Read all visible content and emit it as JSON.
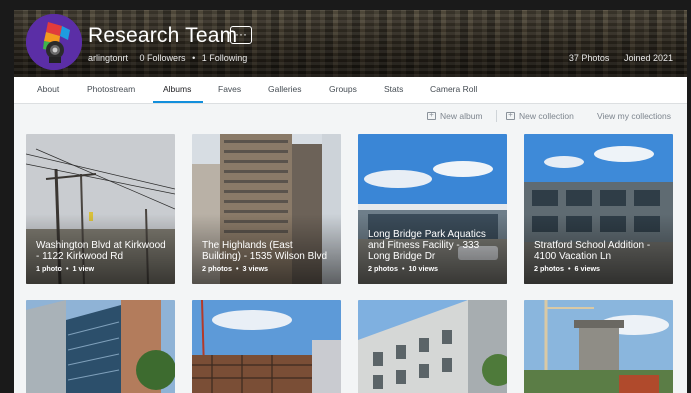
{
  "profile": {
    "name": "Research Team",
    "more_label": "···",
    "username": "arlingtonrt",
    "followers": "0 Followers",
    "following": "1 Following",
    "separator": "•",
    "photos": "37 Photos",
    "joined": "Joined 2021"
  },
  "nav": {
    "tabs": [
      "About",
      "Photostream",
      "Albums",
      "Faves",
      "Galleries",
      "Groups",
      "Stats",
      "Camera Roll"
    ],
    "active": "Albums"
  },
  "toolbar": {
    "new_album": "New album",
    "new_collection": "New collection",
    "view_collections": "View my collections"
  },
  "albums": [
    {
      "title": "Washington Blvd at Kirkwood - 1122 Kirkwood Rd",
      "photos": "1 photo",
      "views": "1 view"
    },
    {
      "title": "The Highlands (East Building) - 1535 Wilson Blvd",
      "photos": "2 photos",
      "views": "3 views"
    },
    {
      "title": "Long Bridge Park Aquatics and Fitness Facility - 333 Long Bridge Dr",
      "photos": "2 photos",
      "views": "10 views"
    },
    {
      "title": "Stratford School Addition - 4100 Vacation Ln",
      "photos": "2 photos",
      "views": "6 views"
    }
  ],
  "meta_separator": "•",
  "colors": {
    "accent": "#128fdc",
    "avatar": "#5b2ea6"
  }
}
